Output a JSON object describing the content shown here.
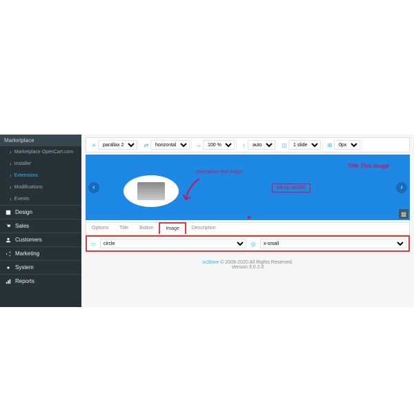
{
  "sidebar": {
    "header": "Marketplace",
    "sub": [
      {
        "label": "Marketplace OpenCart.com"
      },
      {
        "label": "Installer"
      },
      {
        "label": "Extensions",
        "active": true
      },
      {
        "label": "Modifications"
      },
      {
        "label": "Events"
      }
    ],
    "main": [
      {
        "label": "Design"
      },
      {
        "label": "Sales"
      },
      {
        "label": "Customers"
      },
      {
        "label": "Marketing"
      },
      {
        "label": "System"
      },
      {
        "label": "Reports"
      }
    ]
  },
  "toolbar": [
    {
      "icon": "≡",
      "value": "parallax 2"
    },
    {
      "icon": "⇄",
      "value": "horizontal"
    },
    {
      "icon": "↔",
      "value": "100 %"
    },
    {
      "icon": "↕",
      "value": "auto"
    },
    {
      "icon": "◫",
      "value": "1 slide"
    },
    {
      "icon": "⊞",
      "value": "0px"
    }
  ],
  "banner": {
    "desc": "description this image",
    "title": "Title This image",
    "button": "READ MORE"
  },
  "tabs": [
    "Options",
    "Title",
    "Button",
    "Image",
    "Description"
  ],
  "tabActive": 3,
  "imageTab": {
    "shape": "circle",
    "size": "x-small"
  },
  "footer": {
    "brand": "ocStore",
    "copy": " © 2009-2020 All Rights Reserved.",
    "ver": "Version 3.0.2.0"
  }
}
